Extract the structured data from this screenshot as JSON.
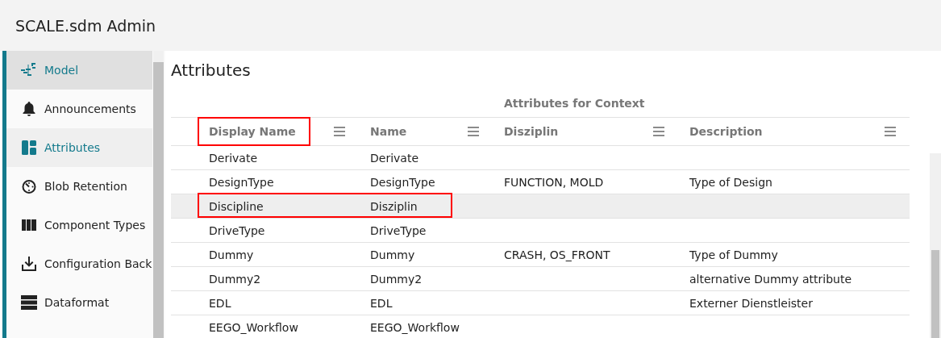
{
  "app": {
    "title": "SCALE.sdm Admin"
  },
  "sidebar": {
    "items": [
      {
        "label": "Model",
        "kind": "model",
        "selected": true,
        "hovered": false
      },
      {
        "label": "Announcements",
        "kind": "bell",
        "selected": false,
        "hovered": false
      },
      {
        "label": "Attributes",
        "kind": "attributes",
        "selected": false,
        "hovered": true
      },
      {
        "label": "Blob Retention",
        "kind": "timer",
        "selected": false,
        "hovered": false
      },
      {
        "label": "Component Types",
        "kind": "columns",
        "selected": false,
        "hovered": false
      },
      {
        "label": "Configuration Back",
        "kind": "download",
        "selected": false,
        "hovered": false
      },
      {
        "label": "Dataformat",
        "kind": "stack",
        "selected": false,
        "hovered": false
      }
    ]
  },
  "page": {
    "title": "Attributes"
  },
  "table": {
    "group_header": "Attributes for Context",
    "columns": [
      {
        "label": "Display Name",
        "outlined": true
      },
      {
        "label": "Name",
        "outlined": false
      },
      {
        "label": "Disziplin",
        "outlined": false
      },
      {
        "label": "Description",
        "outlined": false
      }
    ],
    "rows": [
      {
        "cells": [
          "Derivate",
          "Derivate",
          "",
          ""
        ],
        "selected": false,
        "outlined": false
      },
      {
        "cells": [
          "DesignType",
          "DesignType",
          "FUNCTION, MOLD",
          "Type of Design"
        ],
        "selected": false,
        "outlined": false
      },
      {
        "cells": [
          "Discipline",
          "Disziplin",
          "",
          ""
        ],
        "selected": true,
        "outlined": true
      },
      {
        "cells": [
          "DriveType",
          "DriveType",
          "",
          ""
        ],
        "selected": false,
        "outlined": false
      },
      {
        "cells": [
          "Dummy",
          "Dummy",
          "CRASH, OS_FRONT",
          "Type of Dummy"
        ],
        "selected": false,
        "outlined": false
      },
      {
        "cells": [
          "Dummy2",
          "Dummy2",
          "",
          "alternative Dummy attribute"
        ],
        "selected": false,
        "outlined": false
      },
      {
        "cells": [
          "EDL",
          "EDL",
          "",
          "Externer Dienstleister"
        ],
        "selected": false,
        "outlined": false
      },
      {
        "cells": [
          "EEGO_Workflow",
          "EEGO_Workflow",
          "",
          ""
        ],
        "selected": false,
        "outlined": false
      }
    ]
  }
}
